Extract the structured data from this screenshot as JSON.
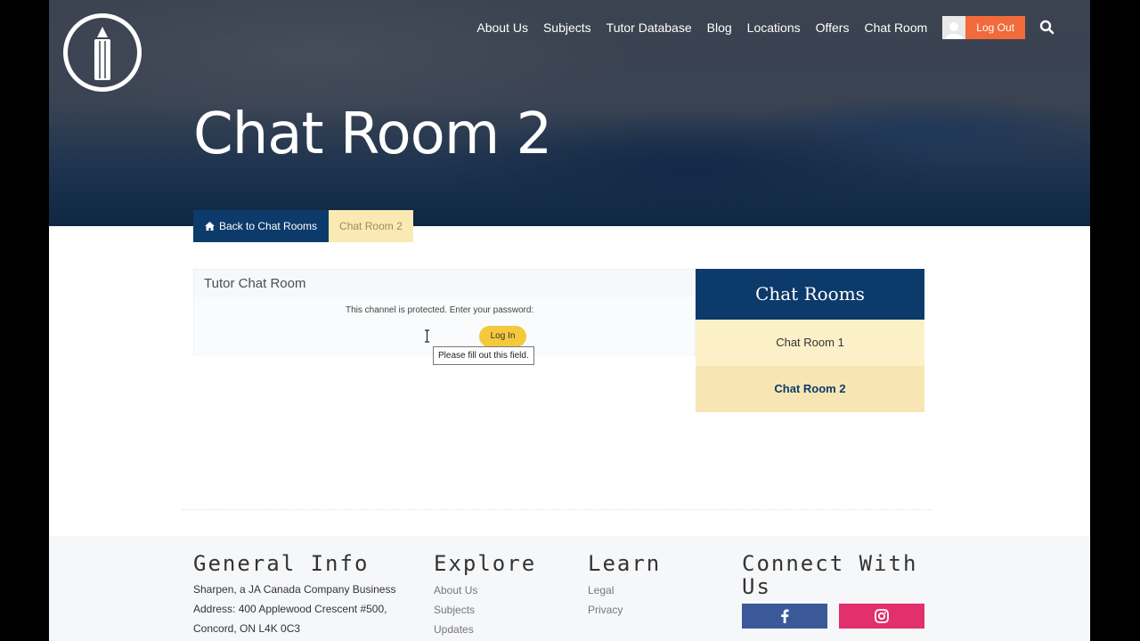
{
  "nav": {
    "items": [
      "About Us",
      "Subjects",
      "Tutor Database",
      "Blog",
      "Locations",
      "Offers",
      "Chat Room"
    ],
    "logout_label": "Log Out"
  },
  "hero": {
    "title": "Chat Room 2"
  },
  "breadcrumb": {
    "back_label": "Back to Chat Rooms",
    "current_label": "Chat Room 2"
  },
  "chat": {
    "panel_title": "Tutor Chat Room",
    "protected_message": "This channel is protected. Enter your password:",
    "password_value": "",
    "login_label": "Log In",
    "tooltip": "Please fill out this field."
  },
  "rooms": {
    "heading": "Chat Rooms",
    "items": [
      "Chat Room 1",
      "Chat Room 2"
    ]
  },
  "footer": {
    "general": {
      "heading": "General Info",
      "lines": [
        "Sharpen, a JA Canada Company Business",
        "Address: 400 Applewood Crescent #500,",
        "Concord, ON L4K 0C3"
      ]
    },
    "explore": {
      "heading": "Explore",
      "links": [
        "About Us",
        "Subjects",
        "Updates"
      ]
    },
    "learn": {
      "heading": "Learn",
      "links": [
        "Legal",
        "Privacy"
      ]
    },
    "connect": {
      "heading": "Connect With Us"
    }
  },
  "colors": {
    "navy": "#0c3a6b",
    "logout": "#f26a3b",
    "gold": "#f5c93d",
    "facebook": "#3b5998",
    "instagram": "#e1306c"
  },
  "icons": [
    "pencil-logo-icon",
    "user-avatar-icon",
    "search-icon",
    "home-icon",
    "text-cursor-icon",
    "facebook-icon",
    "instagram-icon"
  ]
}
